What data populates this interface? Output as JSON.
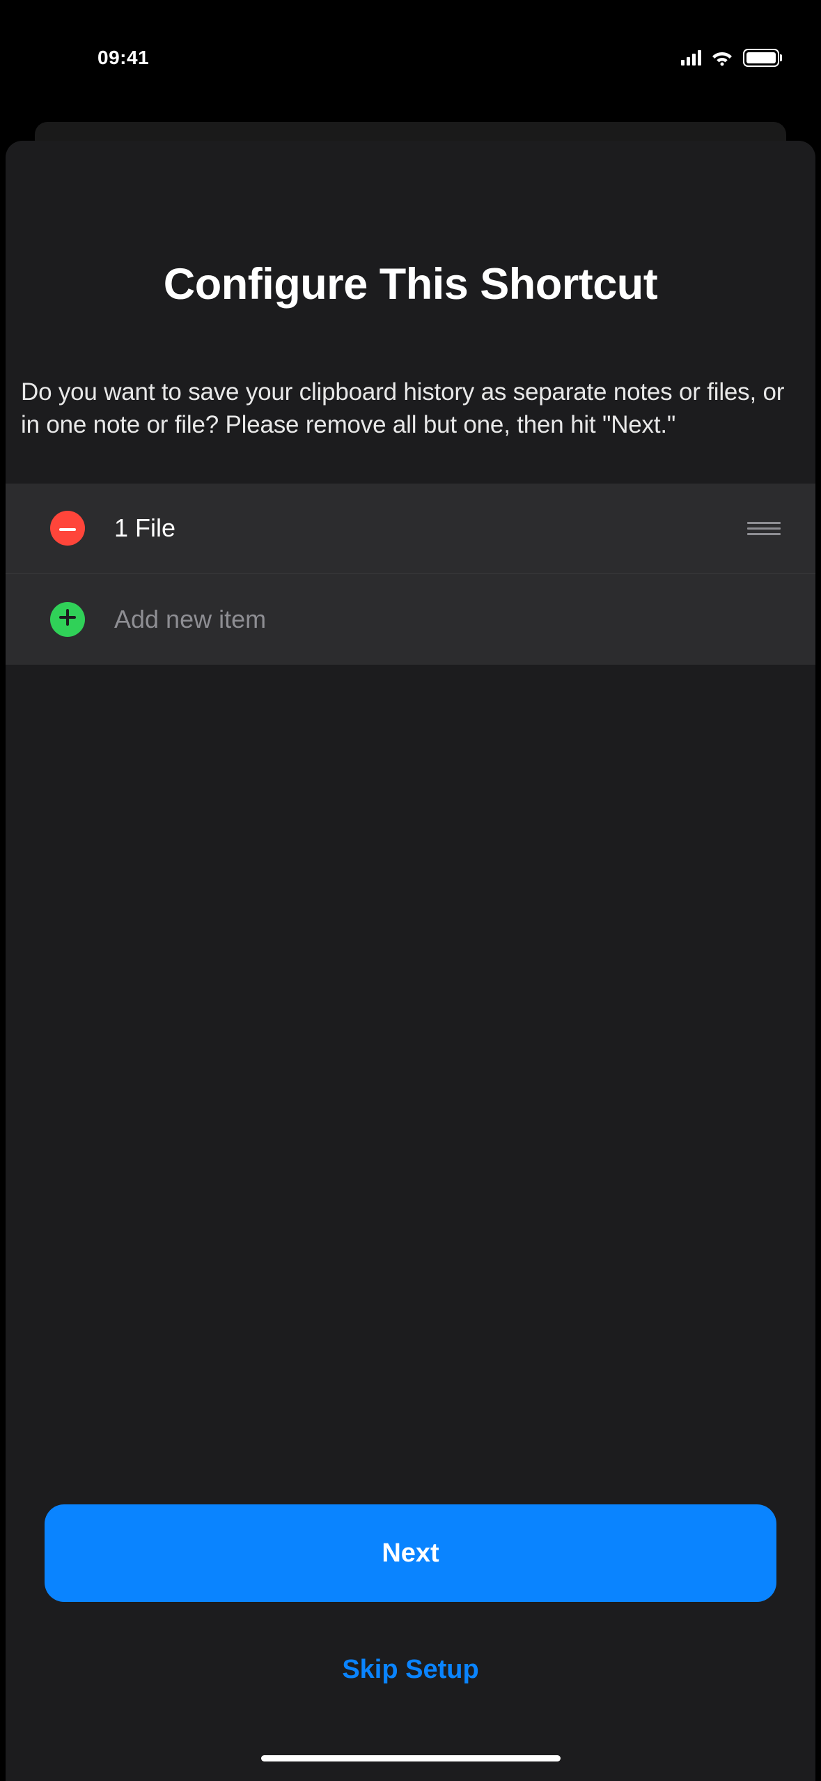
{
  "statusBar": {
    "time": "09:41"
  },
  "sheet": {
    "title": "Configure This Shortcut",
    "description": "Do you want to save your clipboard history as separate notes or files, or in one note or file? Please remove all but one, then hit \"Next.\""
  },
  "list": {
    "items": [
      {
        "label": "1 File"
      }
    ],
    "addPlaceholder": "Add new item"
  },
  "footer": {
    "nextLabel": "Next",
    "skipLabel": "Skip Setup"
  }
}
